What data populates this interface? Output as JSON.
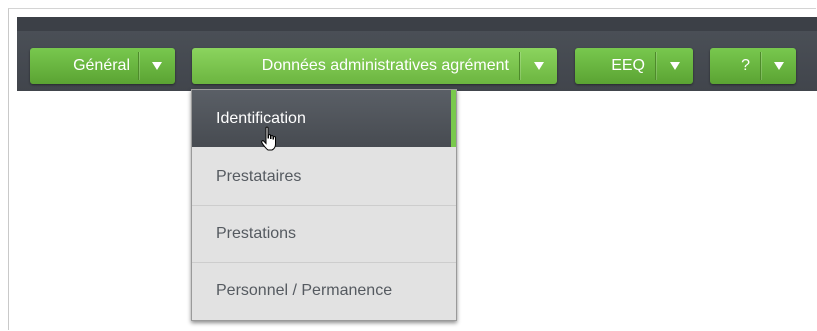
{
  "navbar": {
    "menus": [
      {
        "label": "Général",
        "caret": "chevron-down-icon"
      },
      {
        "label": "Données administratives agrément",
        "caret": "chevron-down-icon"
      },
      {
        "label": "EEQ",
        "caret": "chevron-down-icon"
      },
      {
        "label": "?",
        "caret": "chevron-down-icon"
      }
    ]
  },
  "dropdown": {
    "items": [
      {
        "label": "Identification",
        "selected": true
      },
      {
        "label": "Prestataires"
      },
      {
        "label": "Prestations"
      },
      {
        "label": "Personnel / Permanence"
      }
    ]
  },
  "colors": {
    "accent_green": "#6cb540",
    "navbar_dark": "#41454c",
    "menu_bg": "#e2e2e2"
  }
}
